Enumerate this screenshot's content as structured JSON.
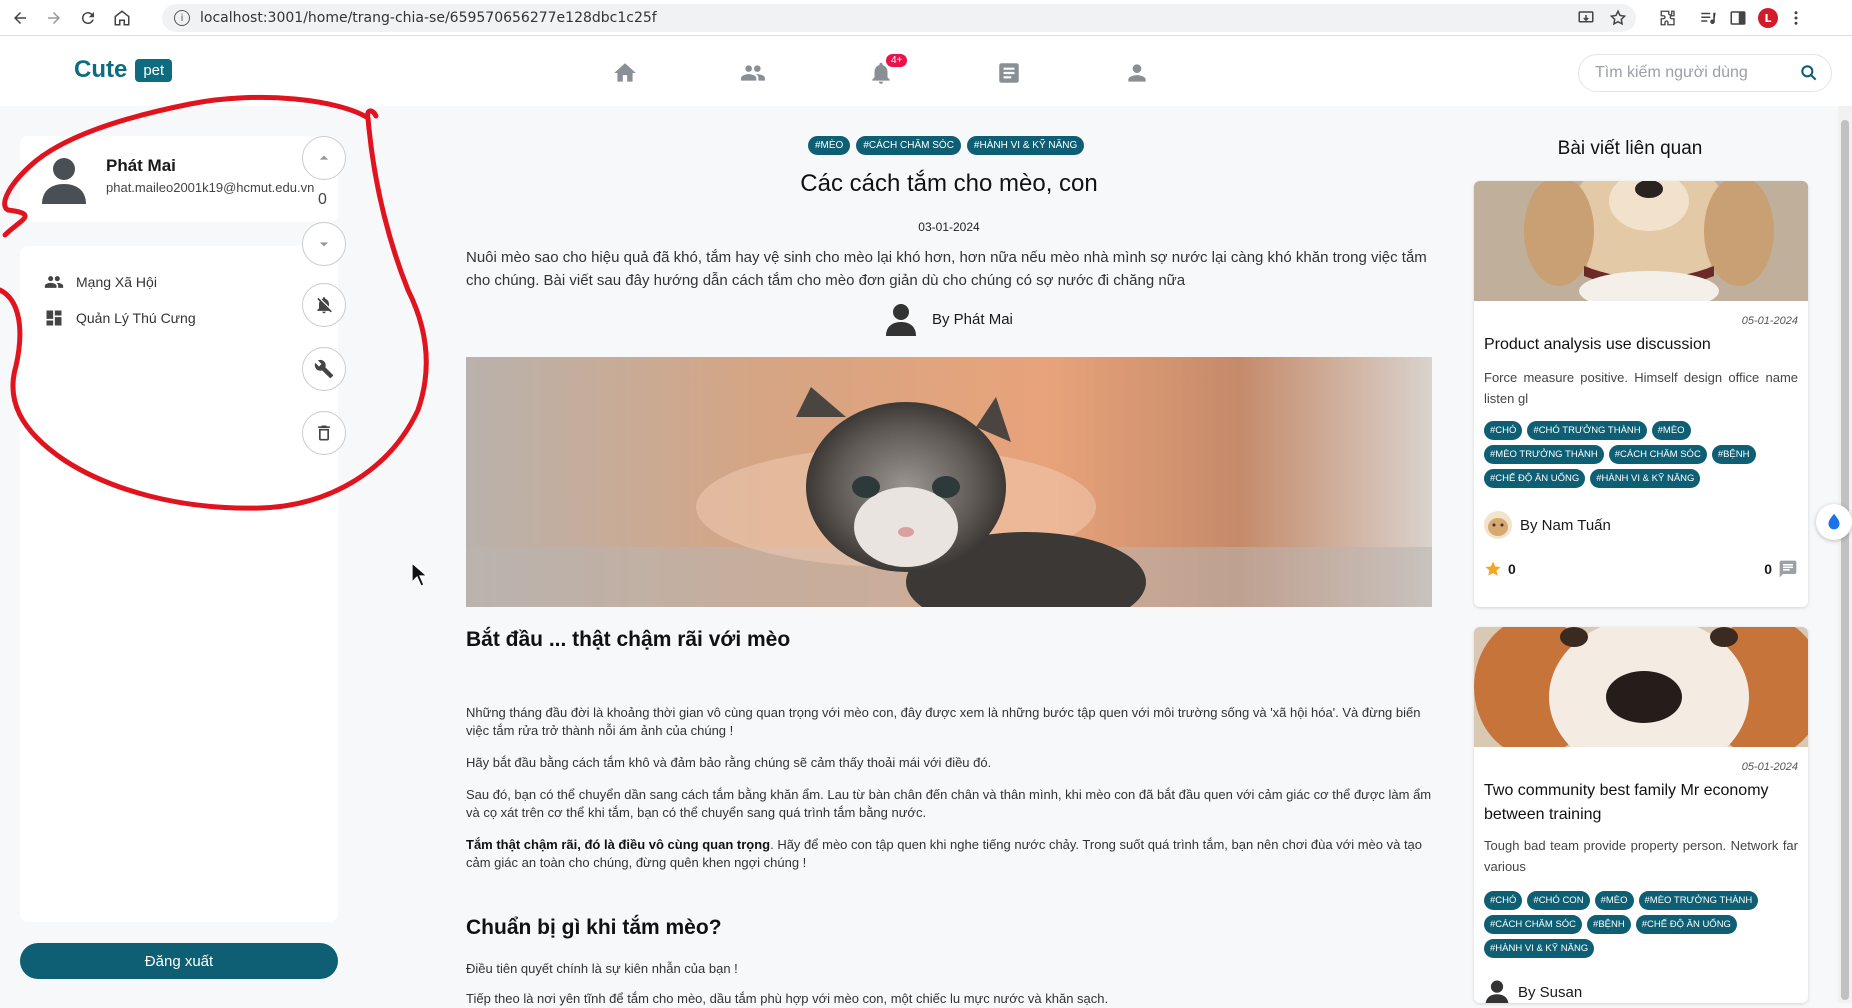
{
  "browser": {
    "url": "localhost:3001/home/trang-chia-se/659570656277e128dbc1c25f",
    "profile_initial": "L"
  },
  "header": {
    "logo_text": "Cute",
    "logo_badge": "pet",
    "notification_count": "4+",
    "search_placeholder": "Tìm kiếm người dùng"
  },
  "sidebar": {
    "user_name": "Phát Mai",
    "user_email": "phat.maileo2001k19@hcmut.edu.vn",
    "vote_count": "0",
    "menu": [
      {
        "label": "Mạng Xã Hội",
        "icon": "people-icon"
      },
      {
        "label": "Quản Lý Thú Cưng",
        "icon": "dashboard-icon"
      }
    ],
    "logout_label": "Đăng xuất"
  },
  "article": {
    "tags": [
      "#MÈO",
      "#CÁCH CHĂM SÓC",
      "#HÀNH VI & KỸ NĂNG"
    ],
    "title": "Các cách tắm cho mèo, con",
    "date": "03-01-2024",
    "intro": "Nuôi mèo sao cho hiệu quả đã khó, tắm hay vệ sinh cho mèo lại khó hơn, hơn nữa nếu mèo nhà mình sợ nước lại càng khó khăn trong việc tắm cho chúng. Bài viết sau đây hướng dẫn cách tắm cho mèo đơn giản dù cho chúng có sợ nước đi chăng nữa",
    "author": "By Phát Mai",
    "section1_title": "Bắt đầu ... thật chậm rãi với mèo",
    "p1": "Những tháng đầu đời là khoảng thời gian vô cùng quan trọng với mèo con, đây được xem là những bước tập quen với môi trường sống và 'xã hội hóa'. Và đừng biến việc tắm rửa trở thành nỗi ám ảnh của chúng !",
    "p2": "Hãy bắt đầu bằng cách tắm khô và đảm bảo rằng chúng sẽ cảm thấy thoải mái với điều đó.",
    "p3": "Sau đó, bạn có thể chuyển dần sang cách tắm bằng khăn ẩm. Lau từ bàn chân đến chân và thân mình, khi mèo con đã bắt đầu quen với cảm giác cơ thể được làm ẩm và cọ xát trên cơ thể khi tắm, bạn có thể chuyển sang quá trình tắm bằng nước.",
    "p4_bold": "Tắm thật chậm rãi, đó là điều vô cùng quan trọng",
    "p4_rest": ". Hãy để mèo con tập quen khi nghe tiếng nước chảy. Trong suốt quá trình tắm, bạn nên chơi đùa với mèo và tạo cảm giác an toàn cho chúng, đừng quên khen ngợi chúng !",
    "section2_title": "Chuẩn bị gì khi tắm mèo?",
    "p5": "Điều tiên quyết chính là sự kiên nhẫn của bạn !",
    "p6": "Tiếp theo là nơi yên tĩnh để tắm cho mèo, dầu tắm phù hợp với mèo con, một chiếc lu mực nước và khăn sạch."
  },
  "related": {
    "heading": "Bài viết liên quan",
    "cards": [
      {
        "date": "05-01-2024",
        "title": "Product analysis use discussion",
        "desc": "Force measure positive. Himself design office name listen gl",
        "tags": [
          "#CHÓ",
          "#CHÓ TRƯỞNG THÀNH",
          "#MÈO",
          "#MÈO TRƯỞNG THÀNH",
          "#CÁCH CHĂM SÓC",
          "#BỆNH",
          "#CHẾ ĐỘ ĂN UỐNG",
          "#HÀNH VI & KỸ NĂNG"
        ],
        "author": "By Nam Tuấn",
        "stars": "0",
        "comments": "0"
      },
      {
        "date": "05-01-2024",
        "title": "Two community best family Mr economy between training",
        "desc": "Tough bad team provide property person. Network far various",
        "tags": [
          "#CHÓ",
          "#CHÓ CON",
          "#MÈO",
          "#MÈO TRƯỞNG THÀNH",
          "#CÁCH CHĂM SÓC",
          "#BỆNH",
          "#CHẾ ĐỘ ĂN UỐNG",
          "#HÀNH VI & KỸ NĂNG"
        ],
        "author": "By Susan"
      }
    ]
  },
  "colors": {
    "brand": "#0e6c80",
    "tag_bg": "#0e5f74",
    "annotation": "#e0141e",
    "notif": "#e8134b",
    "star": "#f5a623"
  }
}
